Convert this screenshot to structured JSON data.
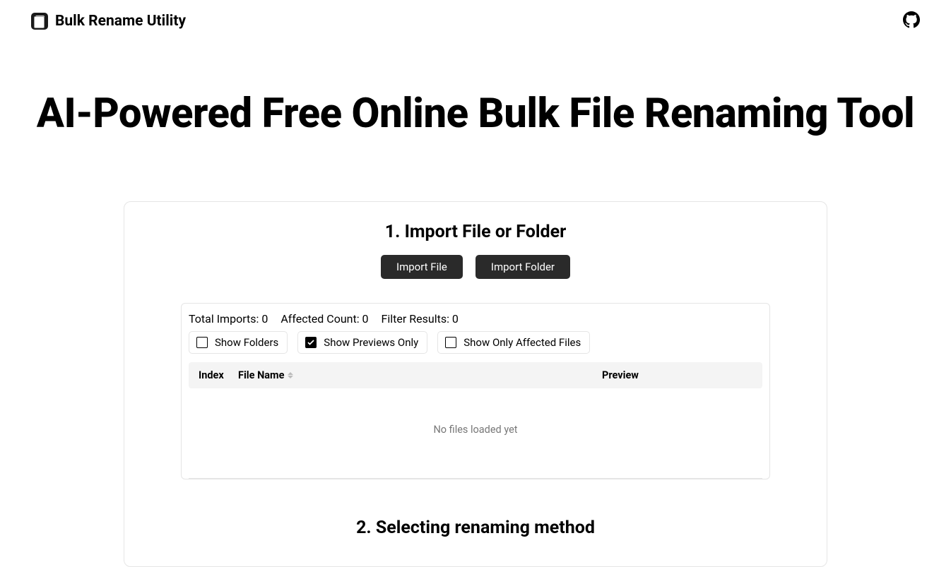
{
  "header": {
    "brand": "Bulk Rename Utility"
  },
  "hero": {
    "title": "AI-Powered Free Online Bulk File Renaming Tool"
  },
  "section1": {
    "title": "1. Import File or Folder",
    "import_file_label": "Import File",
    "import_folder_label": "Import Folder",
    "stats": {
      "total_imports_label": "Total Imports: 0",
      "affected_count_label": "Affected Count: 0",
      "filter_results_label": "Filter Results: 0"
    },
    "checkboxes": {
      "show_folders": {
        "label": "Show Folders",
        "checked": false
      },
      "show_previews_only": {
        "label": "Show Previews Only",
        "checked": true
      },
      "show_only_affected": {
        "label": "Show Only Affected Files",
        "checked": false
      }
    },
    "table": {
      "col_index": "Index",
      "col_filename": "File Name",
      "col_preview": "Preview",
      "empty_message": "No files loaded yet"
    }
  },
  "section2": {
    "title": "2. Selecting renaming method"
  }
}
